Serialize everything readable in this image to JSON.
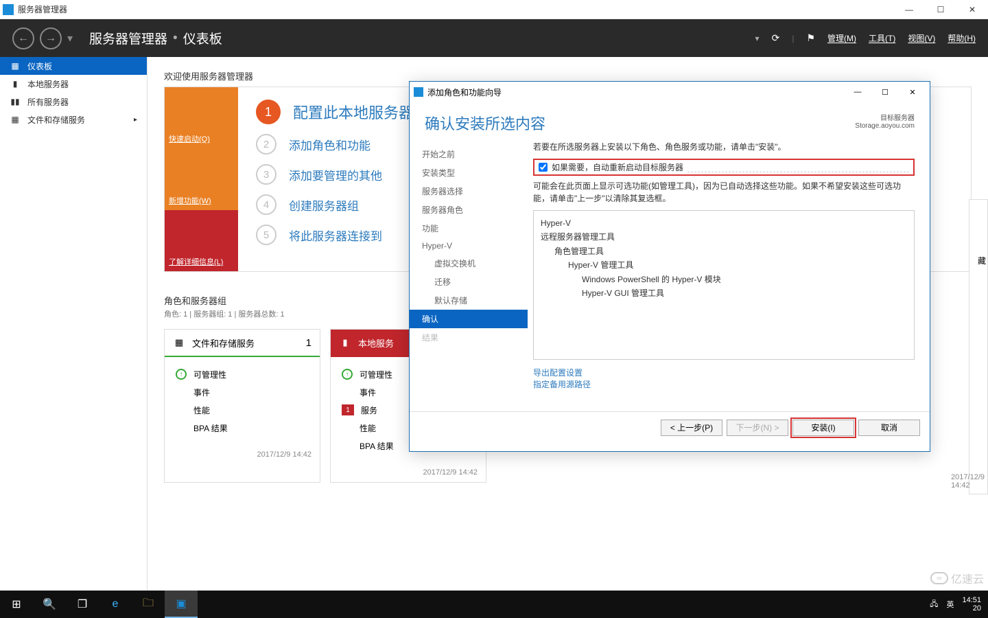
{
  "window": {
    "title": "服务器管理器"
  },
  "header": {
    "crumb_root": "服务器管理器",
    "crumb_page": "仪表板",
    "menu": {
      "manage": "管理(M)",
      "tools": "工具(T)",
      "view": "视图(V)",
      "help": "帮助(H)"
    }
  },
  "sidebar": {
    "items": [
      {
        "label": "仪表板",
        "active": true
      },
      {
        "label": "本地服务器"
      },
      {
        "label": "所有服务器"
      },
      {
        "label": "文件和存储服务",
        "chev": true
      }
    ]
  },
  "welcome": "欢迎使用服务器管理器",
  "hero_left": {
    "quickstart": "快速启动(Q)",
    "whatsnew": "新增功能(W)",
    "learnmore": "了解详细信息(L)"
  },
  "steps": [
    {
      "n": "1",
      "text": "配置此本地服务器",
      "big": true
    },
    {
      "n": "2",
      "text": "添加角色和功能"
    },
    {
      "n": "3",
      "text": "添加要管理的其他"
    },
    {
      "n": "4",
      "text": "创建服务器组"
    },
    {
      "n": "5",
      "text": "将此服务器连接到"
    }
  ],
  "roles_section": {
    "title": "角色和服务器组",
    "sub": "角色: 1 | 服务器组: 1 | 服务器总数: 1"
  },
  "tiles": [
    {
      "title": "文件和存储服务",
      "count": "1",
      "rows": [
        "可管理性",
        "事件",
        "性能",
        "BPA 结果"
      ],
      "foot": "2017/12/9 14:42"
    },
    {
      "title": "本地服务",
      "count": "",
      "rows": [
        "可管理性",
        "事件",
        "服务",
        "性能",
        "BPA 结果"
      ],
      "svc_badge": "1",
      "foot": "2017/12/9 14:42",
      "red": true
    }
  ],
  "crop_panel_foot": "2017/12/9 14:42",
  "wizard": {
    "title": "添加角色和功能向导",
    "heading": "确认安装所选内容",
    "target_label": "目标服务器",
    "target_value": "Storage.aoyou.com",
    "steps": [
      "开始之前",
      "安装类型",
      "服务器选择",
      "服务器角色",
      "功能",
      "Hyper-V"
    ],
    "substeps": [
      "虚拟交换机",
      "迁移",
      "默认存储"
    ],
    "confirm": "确认",
    "results": "结果",
    "intro": "若要在所选服务器上安装以下角色、角色服务或功能，请单击\"安装\"。",
    "checkbox": "如果需要，自动重新启动目标服务器",
    "note": "可能会在此页面上显示可选功能(如管理工具)，因为已自动选择这些功能。如果不希望安装这些可选功能，请单击\"上一步\"以清除其复选框。",
    "features": {
      "f0": "Hyper-V",
      "f1": "远程服务器管理工具",
      "f2": "角色管理工具",
      "f3": "Hyper-V 管理工具",
      "f4": "Windows PowerShell 的 Hyper-V 模块",
      "f5": "Hyper-V GUI 管理工具"
    },
    "links": {
      "export": "导出配置设置",
      "altsource": "指定备用源路径"
    },
    "buttons": {
      "prev": "< 上一步(P)",
      "next": "下一步(N) >",
      "install": "安装(I)",
      "cancel": "取消"
    }
  },
  "taskbar": {
    "ime": "英",
    "time": "14:51",
    "date_partial": "20"
  },
  "watermark": "亿速云"
}
